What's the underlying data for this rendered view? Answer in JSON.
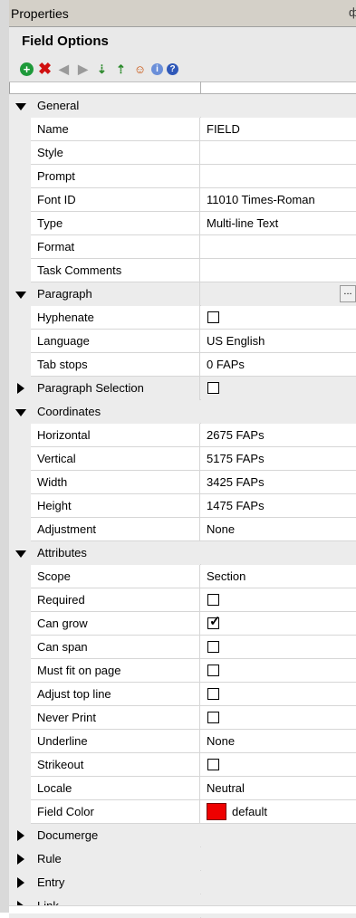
{
  "panel": {
    "title": "Properties",
    "pin_glyph": "ф"
  },
  "header": {
    "title": "Field Options"
  },
  "toolbar": {
    "buttons": [
      {
        "name": "add-icon",
        "glyph": "+"
      },
      {
        "name": "delete-icon",
        "glyph": "✖"
      },
      {
        "name": "previous-icon",
        "glyph": "◀"
      },
      {
        "name": "next-icon",
        "glyph": "▶"
      },
      {
        "name": "move-down-icon",
        "glyph": "⇣"
      },
      {
        "name": "move-up-icon",
        "glyph": "⇡"
      },
      {
        "name": "user-icon",
        "glyph": "☺"
      },
      {
        "name": "info-icon",
        "glyph": "i"
      },
      {
        "name": "help-icon",
        "glyph": "?"
      }
    ]
  },
  "colors": {
    "field_color": "#ee0000",
    "category_bg": "#ececec"
  },
  "rows": [
    {
      "type": "category",
      "label": "General",
      "expanded": true
    },
    {
      "type": "prop",
      "label": "Name",
      "value": "FIELD"
    },
    {
      "type": "prop",
      "label": "Style",
      "value": ""
    },
    {
      "type": "prop",
      "label": "Prompt",
      "value": ""
    },
    {
      "type": "prop",
      "label": "Font ID",
      "value": "11010 Times-Roman"
    },
    {
      "type": "prop",
      "label": "Type",
      "value": "Multi-line Text"
    },
    {
      "type": "prop",
      "label": "Format",
      "value": ""
    },
    {
      "type": "prop",
      "label": "Task Comments",
      "value": ""
    },
    {
      "type": "category",
      "label": "Paragraph",
      "expanded": true,
      "button": "..."
    },
    {
      "type": "prop",
      "label": "Hyphenate",
      "checkbox": false
    },
    {
      "type": "prop",
      "label": "Language",
      "value": "US English"
    },
    {
      "type": "prop",
      "label": "Tab stops",
      "value": "0 FAPs"
    },
    {
      "type": "category",
      "label": "Paragraph Selection",
      "expanded": false,
      "checkbox": false
    },
    {
      "type": "category",
      "label": "Coordinates",
      "expanded": true
    },
    {
      "type": "prop",
      "label": "Horizontal",
      "value": "2675 FAPs"
    },
    {
      "type": "prop",
      "label": "Vertical",
      "value": "5175 FAPs"
    },
    {
      "type": "prop",
      "label": "Width",
      "value": "3425 FAPs"
    },
    {
      "type": "prop",
      "label": "Height",
      "value": "1475 FAPs"
    },
    {
      "type": "prop",
      "label": "Adjustment",
      "value": "None"
    },
    {
      "type": "category",
      "label": "Attributes",
      "expanded": true
    },
    {
      "type": "prop",
      "label": "Scope",
      "value": "Section"
    },
    {
      "type": "prop",
      "label": "Required",
      "checkbox": false
    },
    {
      "type": "prop",
      "label": "Can grow",
      "checkbox": true
    },
    {
      "type": "prop",
      "label": "Can span",
      "checkbox": false
    },
    {
      "type": "prop",
      "label": "Must fit on page",
      "checkbox": false
    },
    {
      "type": "prop",
      "label": "Adjust top line",
      "checkbox": false
    },
    {
      "type": "prop",
      "label": "Never Print",
      "checkbox": false
    },
    {
      "type": "prop",
      "label": "Underline",
      "value": "None"
    },
    {
      "type": "prop",
      "label": "Strikeout",
      "checkbox": false
    },
    {
      "type": "prop",
      "label": "Locale",
      "value": "Neutral"
    },
    {
      "type": "prop",
      "label": "Field Color",
      "value": "default",
      "swatch": "#ee0000"
    },
    {
      "type": "category",
      "label": "Documerge",
      "expanded": false
    },
    {
      "type": "category",
      "label": "Rule",
      "expanded": false
    },
    {
      "type": "category",
      "label": "Entry",
      "expanded": false
    },
    {
      "type": "category",
      "label": "Link",
      "expanded": false
    }
  ]
}
